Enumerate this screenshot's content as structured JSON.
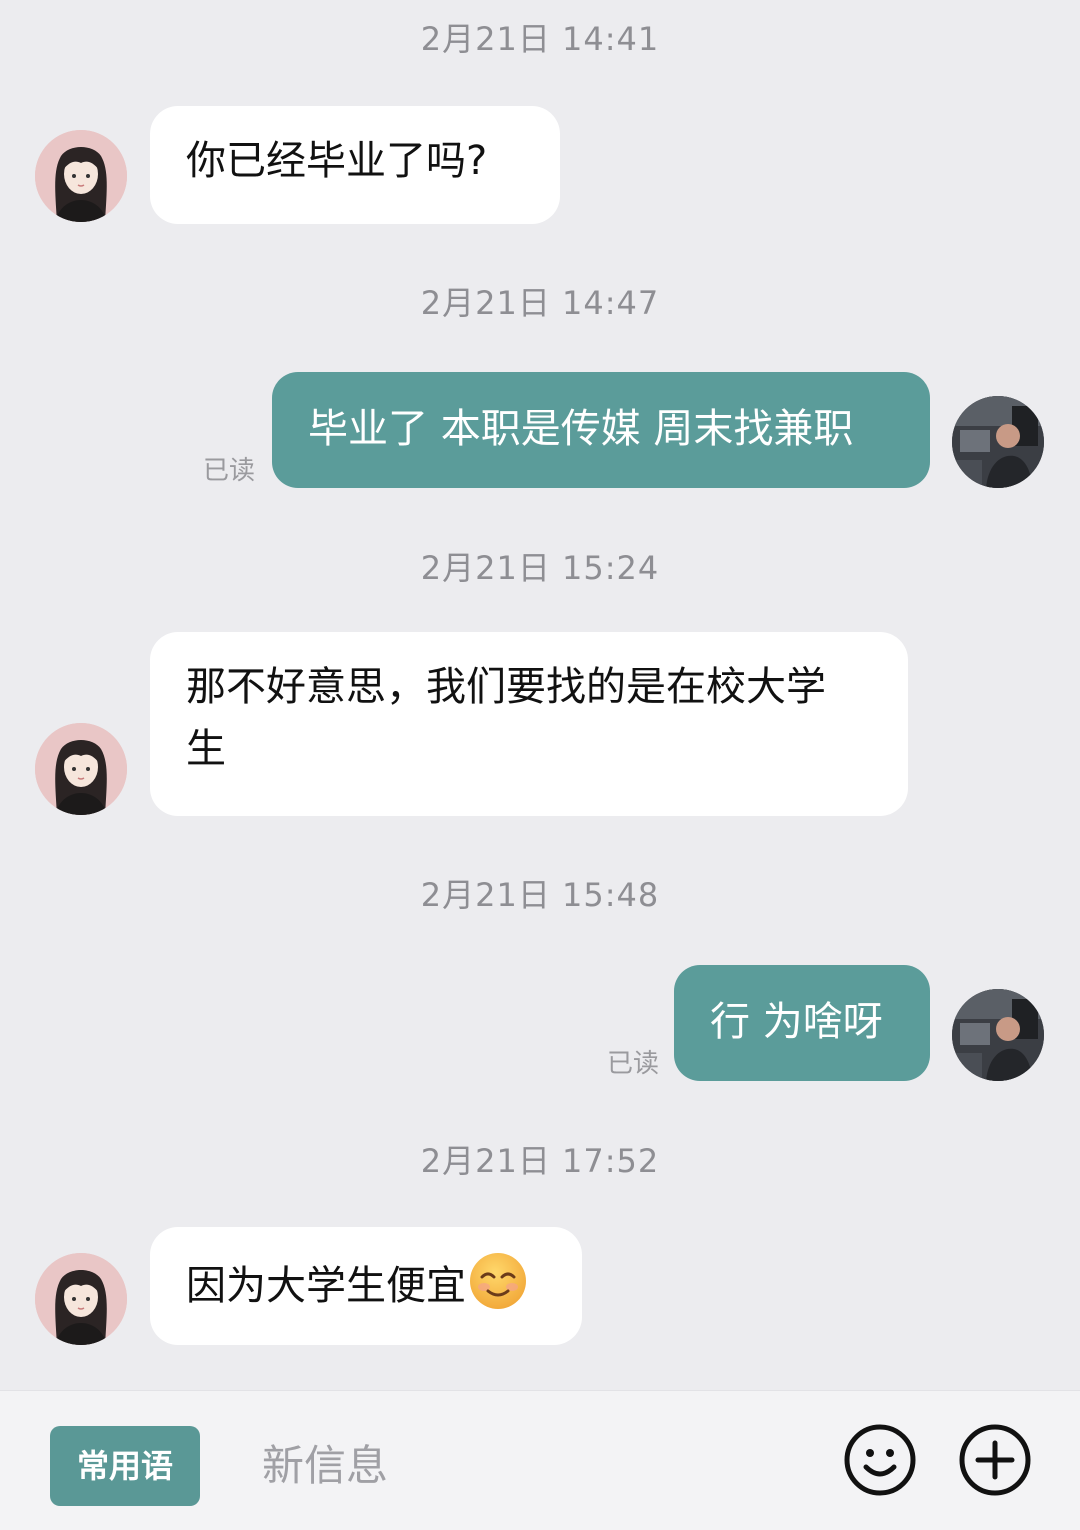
{
  "messages": [
    {
      "timestamp": "2月21日 14:41",
      "side": "in",
      "text": "你已经毕业了吗?"
    },
    {
      "timestamp": "2月21日 14:47",
      "side": "out",
      "text": "毕业了 本职是传媒 周末找兼职",
      "status": "已读"
    },
    {
      "timestamp": "2月21日 15:24",
      "side": "in",
      "line1": "那不好意思，我们要找的是在校大学",
      "line2": "生"
    },
    {
      "timestamp": "2月21日 15:48",
      "side": "out",
      "text": "行 为啥呀",
      "status": "已读"
    },
    {
      "timestamp": "2月21日 17:52",
      "side": "in",
      "text": "因为大学生便宜",
      "emoji": "smiling-face-emoji"
    }
  ],
  "composer": {
    "phrase_button": "常用语",
    "placeholder": "新信息",
    "emoji_icon": "smiley-icon",
    "add_icon": "plus-circle-icon"
  },
  "colors": {
    "background": "#ececef",
    "outgoing_bubble": "#5b9c9a",
    "incoming_bubble": "#ffffff",
    "phrase_button": "#5a9896"
  }
}
